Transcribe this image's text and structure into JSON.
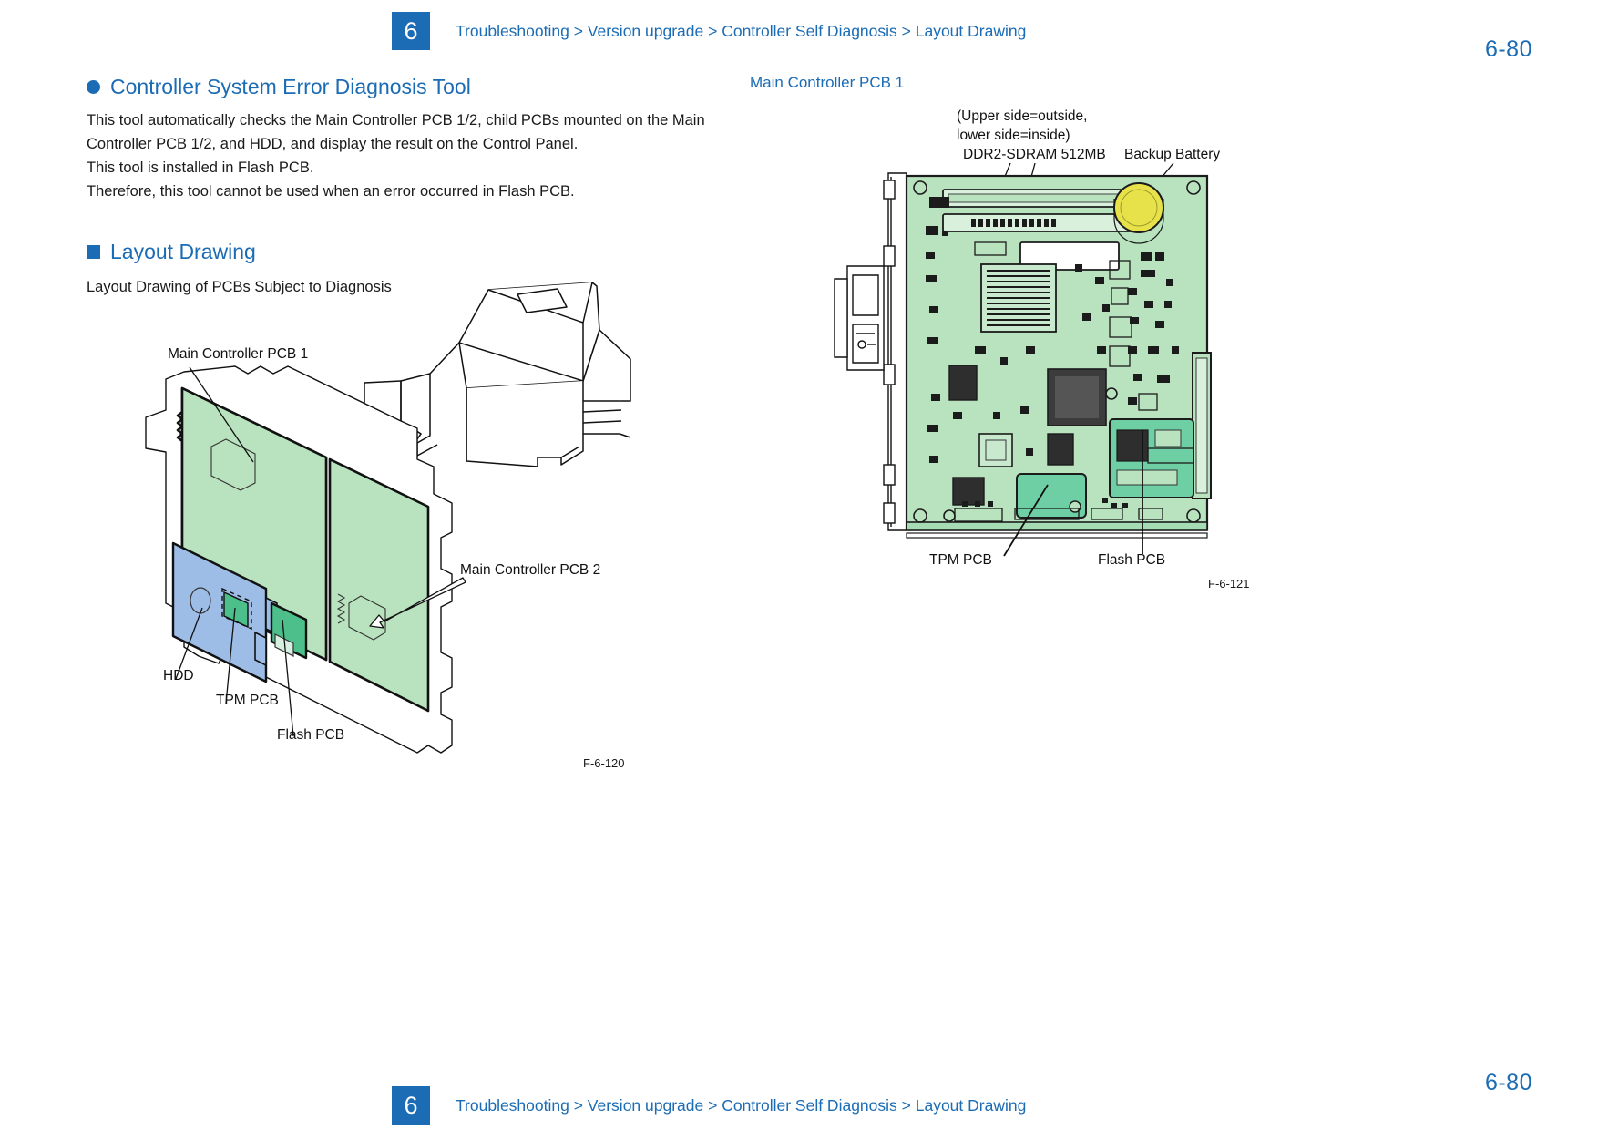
{
  "header": {
    "chapter_number": "6",
    "breadcrumb": "Troubleshooting > Version upgrade > Controller Self Diagnosis > Layout Drawing",
    "page_number": "6-80"
  },
  "footer": {
    "chapter_number": "6",
    "breadcrumb": "Troubleshooting > Version upgrade > Controller Self Diagnosis > Layout Drawing",
    "page_number": "6-80"
  },
  "colors": {
    "accent_blue": "#1b6cb5",
    "pcb_green_light": "#b9e3bf",
    "pcb_green_mid": "#a5dcb4",
    "pcb_green_dark": "#4cbf8a",
    "hdd_blue": "#9dbde6",
    "battery_yellow": "#e8e24a",
    "body_text": "#1a1a1a"
  },
  "left_column": {
    "section_heading": "Controller System Error Diagnosis Tool",
    "paragraph_lines": [
      "This tool automatically checks the Main Controller PCB 1/2, child PCBs mounted on the Main",
      "Controller PCB 1/2, and HDD, and display the result on the Control Panel.",
      "This tool is installed in Flash PCB.",
      "Therefore, this tool cannot be used when an error occurred in Flash PCB."
    ],
    "subsection_heading": "Layout Drawing",
    "subsection_subtitle": "Layout Drawing of PCBs Subject to Diagnosis"
  },
  "figure_left": {
    "caption": "F-6-120",
    "callouts": {
      "main_controller_pcb_1": "Main Controller PCB 1",
      "main_controller_pcb_2": "Main Controller PCB 2",
      "hdd": "HDD",
      "tpm_pcb": "TPM PCB",
      "flash_pcb": "Flash PCB"
    }
  },
  "figure_right": {
    "title": "Main Controller PCB 1",
    "caption": "F-6-121",
    "callouts": {
      "note_line_1": "(Upper side=outside,",
      "note_line_2": "lower side=inside)",
      "ddr2_sdram": "DDR2-SDRAM 512MB",
      "backup_battery": "Backup Battery",
      "tpm_pcb": "TPM PCB",
      "flash_pcb": "Flash PCB"
    }
  }
}
